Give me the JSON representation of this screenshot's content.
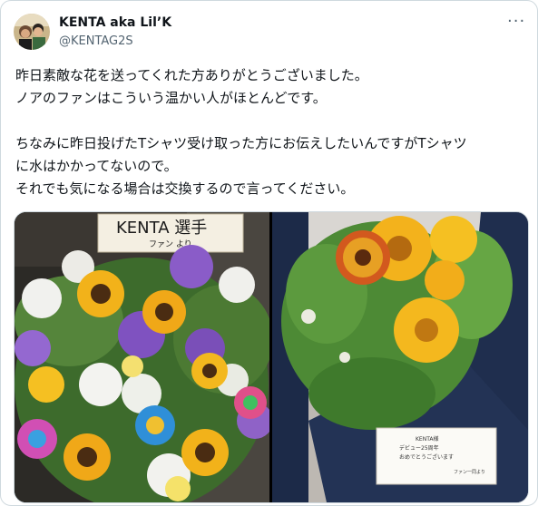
{
  "tweet": {
    "author_name": "KENTA aka Lil’K",
    "author_handle": "@KENTAG2S",
    "more_icon": "more-horizontal-icon",
    "text_lines": [
      "昨日素敵な花を送ってくれた方ありがとうございました。",
      "ノアのファンはこういう温かい人がほとんどです。",
      "",
      "ちなみに昨日投げたTシャツ受け取った方にお伝えしたいんですがTシャツ",
      "に水はかかってないので。",
      "それでも気になる場合は交換するので言ってください。"
    ]
  },
  "media": {
    "left_photo": {
      "sign_main": "KENTA 選手",
      "sign_sub": "ファン より"
    },
    "right_photo": {
      "card_lines": [
        "KENTA様",
        "デビュー25周年",
        "おめでとうございます",
        "ファン一同より"
      ]
    }
  },
  "colors": {
    "text": "#0f1419",
    "secondary": "#536471",
    "border": "#cfd9de"
  }
}
